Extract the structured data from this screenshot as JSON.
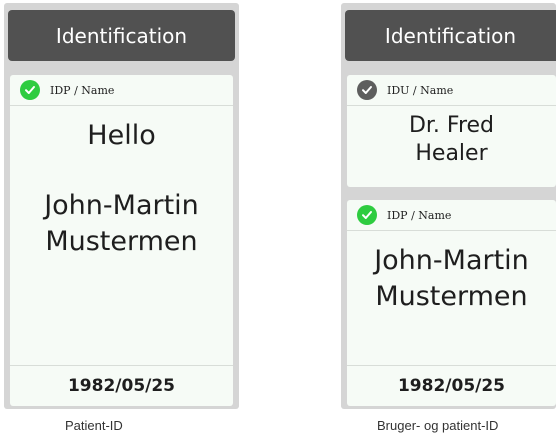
{
  "panels": [
    {
      "header": "Identification",
      "card": {
        "label": "IDP / Name",
        "greeting": "Hello",
        "name_line1": "John-Martin",
        "name_line2": "Mustermen",
        "date": "1982/05/25",
        "icon": "check-circle-green"
      },
      "caption": "Patient-ID"
    },
    {
      "header": "Identification",
      "user_card": {
        "label": "IDU / Name",
        "name_line1": "Dr. Fred",
        "name_line2": "Healer",
        "icon": "check-circle-grey"
      },
      "patient_card": {
        "label": "IDP / Name",
        "name_line1": "John-Martin",
        "name_line2": "Mustermen",
        "date": "1982/05/25",
        "icon": "check-circle-green"
      },
      "caption": "Bruger- og patient-ID"
    }
  ],
  "colors": {
    "header_bg": "#515151",
    "card_bg": "#f6fbf6",
    "check_green": "#2ecc40",
    "check_grey": "#5e5e5e"
  }
}
